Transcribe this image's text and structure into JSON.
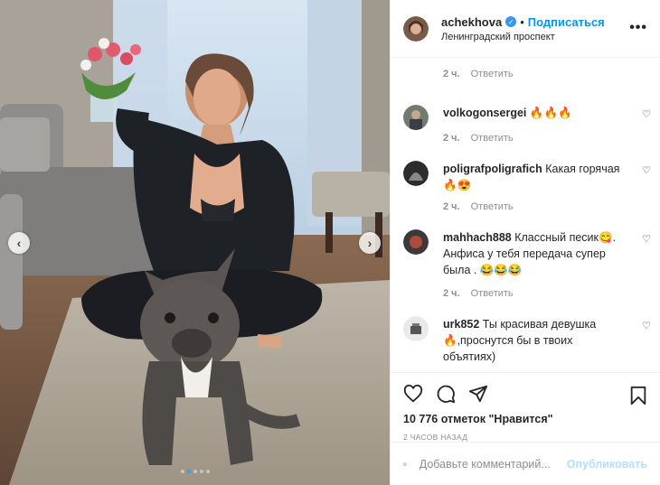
{
  "header": {
    "username": "achekhova",
    "follow_label": "Подписаться",
    "location": "Ленинградский проспект",
    "more_label": "•••"
  },
  "top_meta": {
    "time": "2 ч.",
    "reply": "Ответить"
  },
  "comments": [
    {
      "user": "volkogonsergei",
      "text": "🔥🔥🔥",
      "time": "2 ч.",
      "reply": "Ответить"
    },
    {
      "user": "poligrafpoligrafich",
      "text": "Какая горячая🔥😍",
      "time": "2 ч.",
      "reply": "Ответить"
    },
    {
      "user": "mahhach888",
      "text": "Классный песик😋. Анфиса у тебя передача супер была . 😂😂😂",
      "time": "2 ч.",
      "reply": "Ответить"
    },
    {
      "user": "urk852",
      "text": "Ты красивая девушка 🔥,проснутся бы в твоих объятиях)",
      "time": "",
      "reply": ""
    }
  ],
  "likes": "10 776 отметок \"Нравится\"",
  "posted_ago": "2 ЧАСОВ НАЗАД",
  "add_comment": {
    "placeholder": "Добавьте комментарий...",
    "post_label": "Опубликовать"
  },
  "carousel": {
    "prev": "‹",
    "next": "›",
    "count": 5,
    "active_index": 1
  },
  "colors": {
    "accent": "#0095f6",
    "verified": "#3897f0",
    "post_disabled": "#b2dffc"
  }
}
